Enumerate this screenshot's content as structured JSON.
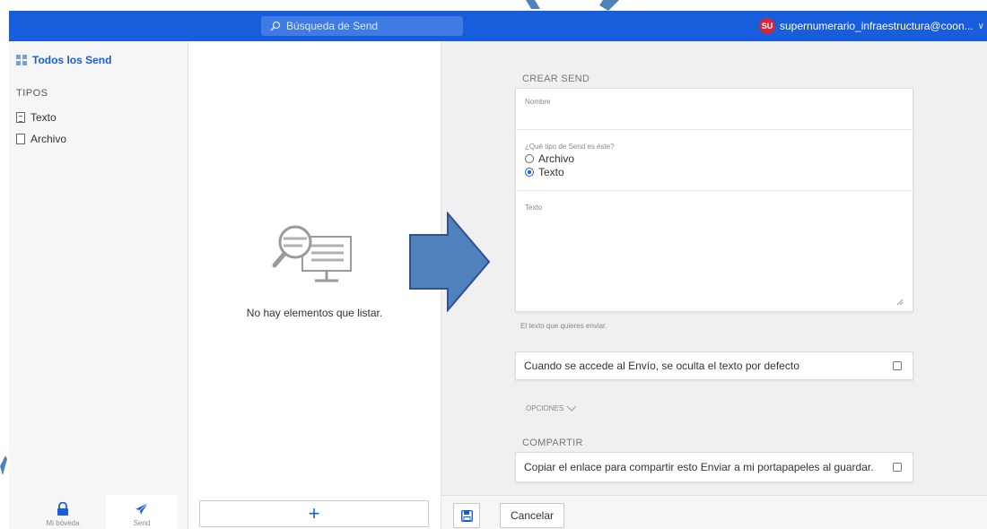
{
  "header": {
    "search_placeholder": "Búsqueda de Send",
    "account_initials": "SU",
    "account_email": "supernumerario_infraestructura@coon..."
  },
  "sidebar": {
    "all_sends_label": "Todos los Send",
    "types_heading": "TIPOS",
    "types": [
      {
        "label": "Texto",
        "icon": "text-file-icon"
      },
      {
        "label": "Archivo",
        "icon": "file-icon"
      }
    ],
    "bottom_nav": [
      {
        "label": "Mi bóveda",
        "icon": "lock-icon",
        "active": false
      },
      {
        "label": "Send",
        "icon": "paper-plane-icon",
        "active": true
      }
    ]
  },
  "list": {
    "empty_message": "No hay elementos que listar.",
    "add_button_symbol": "+"
  },
  "form": {
    "create_heading": "CREAR SEND",
    "name_label": "Nombre",
    "name_value": "",
    "type_question": "¿Qué tipo de Send es éste?",
    "type_options": [
      {
        "label": "Archivo",
        "selected": false
      },
      {
        "label": "Texto",
        "selected": true
      }
    ],
    "text_label": "Texto",
    "text_value": "",
    "text_hint": "El texto que quieres enviar.",
    "hide_text_label": "Cuando se accede al Envío, se oculta el texto por defecto",
    "hide_text_checked": false,
    "options_label": "OPCIONES",
    "share_heading": "COMPARTIR",
    "copy_link_label": "Copiar el enlace para compartir esto Enviar a mi portapapeles al guardar.",
    "copy_link_checked": false
  },
  "footer": {
    "save_icon": "save-icon",
    "cancel_label": "Cancelar"
  },
  "colors": {
    "brand_blue": "#175ddc",
    "arrow_fill": "#4f81bd",
    "arrow_stroke": "#2f528f",
    "avatar_red": "#d22838"
  }
}
